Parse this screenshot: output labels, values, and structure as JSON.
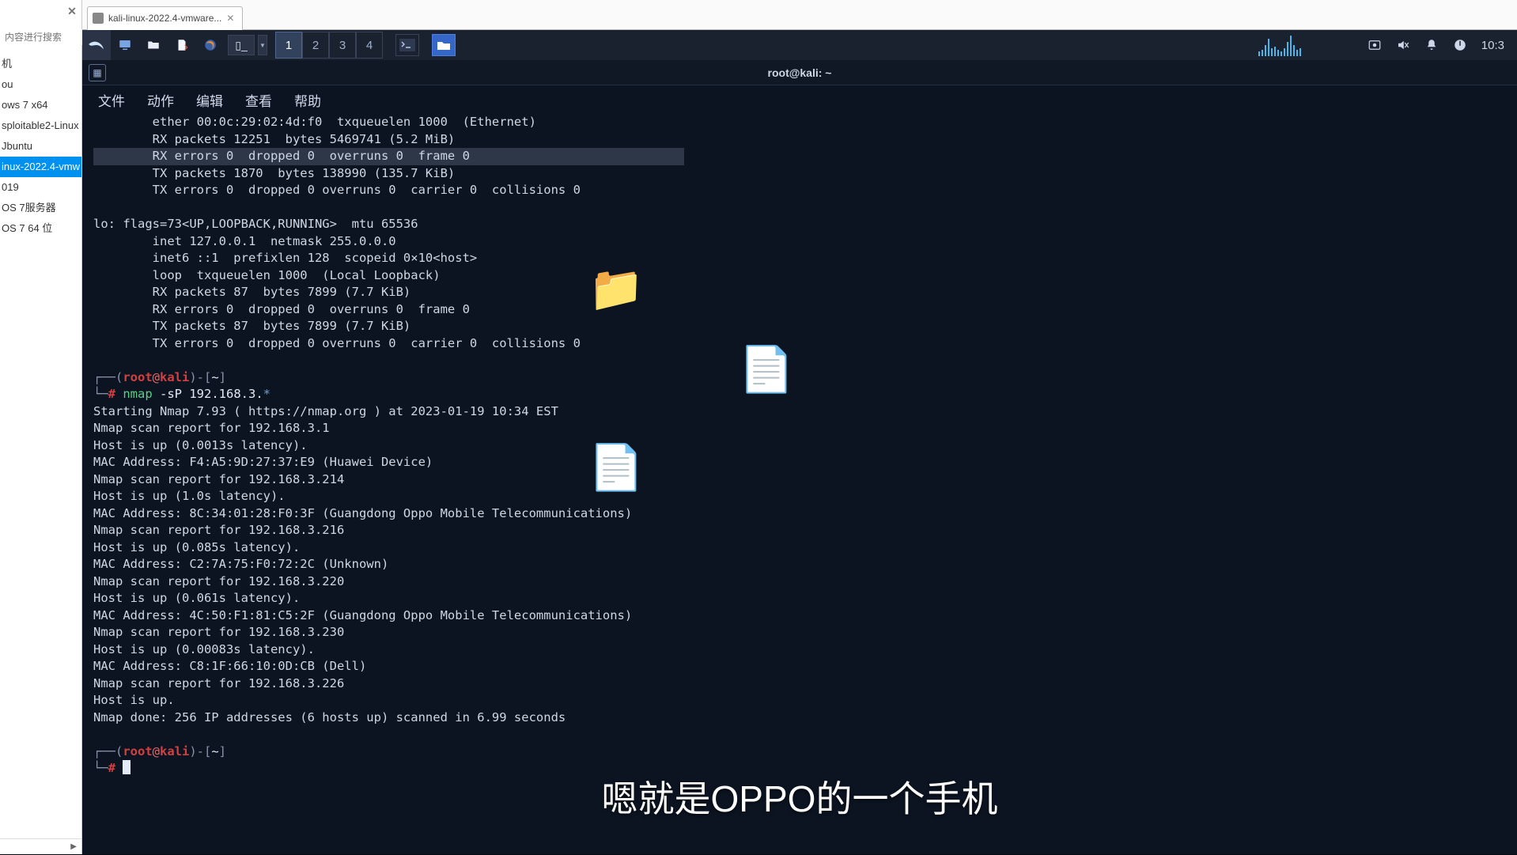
{
  "sidebar": {
    "search_placeholder": "内容进行搜索",
    "items": [
      "机",
      "ou",
      "ows 7 x64",
      "sploitable2-Linux",
      "Jbuntu",
      "inux-2022.4-vmw",
      "019",
      "OS 7服务器",
      "OS 7 64 位"
    ],
    "selected_index": 5
  },
  "vm_tab": {
    "label": "kali-linux-2022.4-vmware..."
  },
  "kali_panel": {
    "workspaces": [
      "1",
      "2",
      "3",
      "4"
    ],
    "active_ws": 0,
    "time": "10:3"
  },
  "terminal": {
    "window_title": "root@kali: ~",
    "menus": [
      "文件",
      "动作",
      "编辑",
      "查看",
      "帮助"
    ],
    "lines_top": [
      "        ether 00:0c:29:02:4d:f0  txqueuelen 1000  (Ethernet)",
      "        RX packets 12251  bytes 5469741 (5.2 MiB)",
      "        RX errors 0  dropped 0  overruns 0  frame 0",
      "        TX packets 1870  bytes 138990 (135.7 KiB)",
      "        TX errors 0  dropped 0 overruns 0  carrier 0  collisions 0",
      "",
      "lo: flags=73<UP,LOOPBACK,RUNNING>  mtu 65536",
      "        inet 127.0.0.1  netmask 255.0.0.0",
      "        inet6 ::1  prefixlen 128  scopeid 0×10<host>",
      "        loop  txqueuelen 1000  (Local Loopback)",
      "        RX packets 87  bytes 7899 (7.7 KiB)",
      "        RX errors 0  dropped 0  overruns 0  frame 0",
      "        TX packets 87  bytes 7899 (7.7 KiB)",
      "        TX errors 0  dropped 0 overruns 0  carrier 0  collisions 0",
      ""
    ],
    "prompt_user": "root",
    "prompt_at": "@",
    "prompt_host": "kali",
    "prompt_path": "~",
    "cmd": "nmap -sP 192.168.3.*",
    "nmap_output": [
      "Starting Nmap 7.93 ( https://nmap.org ) at 2023-01-19 10:34 EST",
      "Nmap scan report for 192.168.3.1",
      "Host is up (0.0013s latency).",
      "MAC Address: F4:A5:9D:27:37:E9 (Huawei Device)",
      "Nmap scan report for 192.168.3.214",
      "Host is up (1.0s latency).",
      "MAC Address: 8C:34:01:28:F0:3F (Guangdong Oppo Mobile Telecommunications)",
      "Nmap scan report for 192.168.3.216",
      "Host is up (0.085s latency).",
      "MAC Address: C2:7A:75:F0:72:2C (Unknown)",
      "Nmap scan report for 192.168.3.220",
      "Host is up (0.061s latency).",
      "MAC Address: 4C:50:F1:81:C5:2F (Guangdong Oppo Mobile Telecommunications)",
      "Nmap scan report for 192.168.3.230",
      "Host is up (0.00083s latency).",
      "MAC Address: C8:1F:66:10:0D:CB (Dell)",
      "Nmap scan report for 192.168.3.226",
      "Host is up.",
      "Nmap done: 256 IP addresses (6 hosts up) scanned in 6.99 seconds"
    ]
  },
  "subtitle": "嗯就是OPPO的一个手机"
}
